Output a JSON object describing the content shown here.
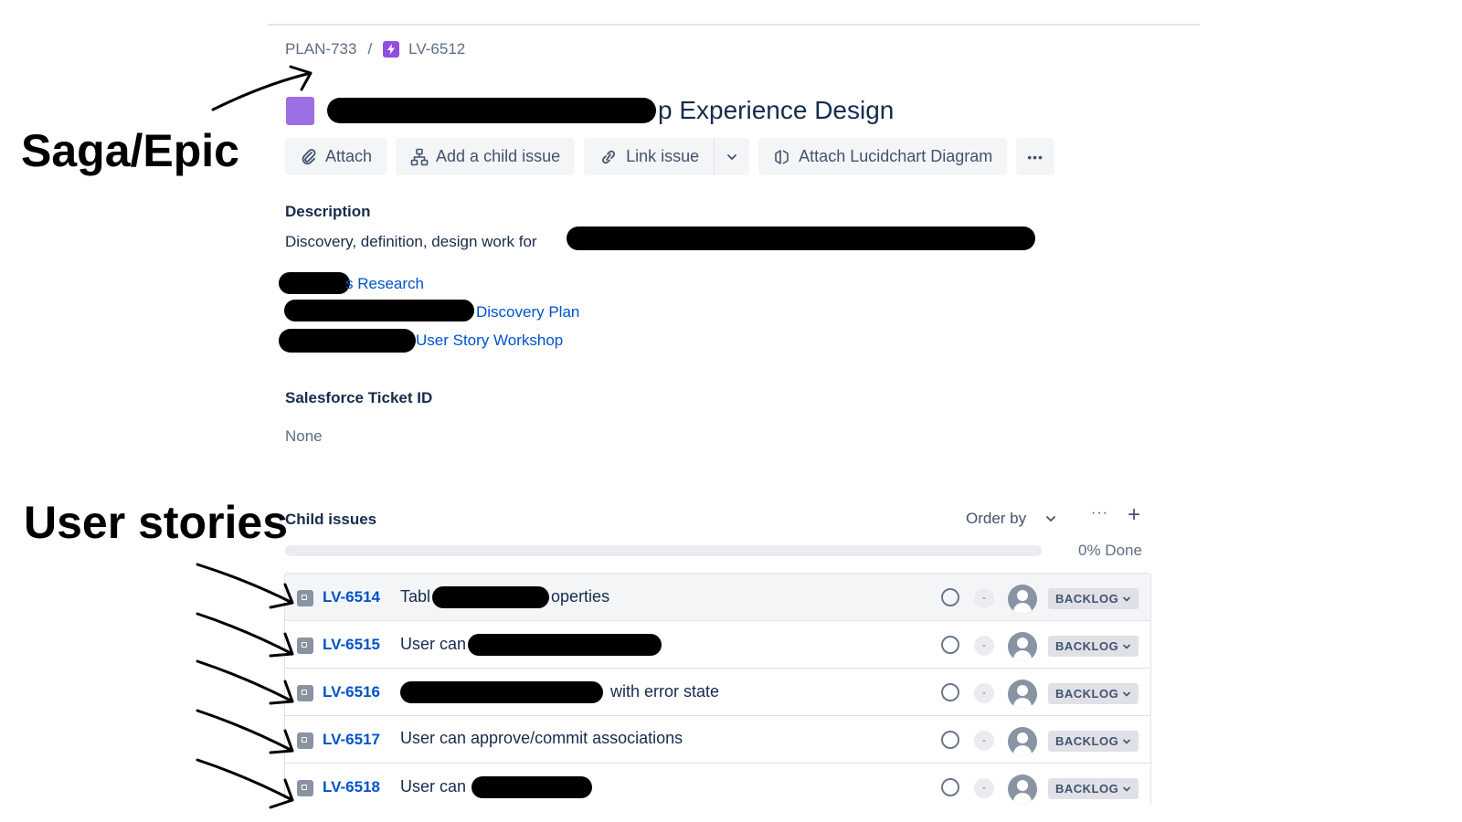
{
  "breadcrumb": {
    "parent": "PLAN-733",
    "separator": "/",
    "current": "LV-6512"
  },
  "issue": {
    "title_suffix": "p Experience Design",
    "epic_color": "#9c6fe4"
  },
  "toolbar": {
    "attach": "Attach",
    "add_child": "Add a child issue",
    "link_issue": "Link issue",
    "lucidchart": "Attach Lucidchart Diagram",
    "more": "•••"
  },
  "description": {
    "label": "Description",
    "text": "Discovery, definition, design work for",
    "links": [
      "s Research",
      "Discovery Plan",
      "User Story Workshop"
    ]
  },
  "salesforce": {
    "label": "Salesforce Ticket ID",
    "value": "None"
  },
  "child_issues": {
    "label": "Child issues",
    "order_by": "Order by",
    "more": "···",
    "add": "+",
    "progress_percent": 0,
    "done_text": "0% Done",
    "items": [
      {
        "key": "LV-6514",
        "summary_pre": "Tabl",
        "summary_post": "operties",
        "status": "BACKLOG",
        "priority": "-"
      },
      {
        "key": "LV-6515",
        "summary_pre": "User can",
        "summary_post": "",
        "status": "BACKLOG",
        "priority": "-"
      },
      {
        "key": "LV-6516",
        "summary_pre": "",
        "summary_post": "with error state",
        "status": "BACKLOG",
        "priority": "-"
      },
      {
        "key": "LV-6517",
        "summary_pre": "User can approve/commit associations",
        "summary_post": "",
        "status": "BACKLOG",
        "priority": "-"
      },
      {
        "key": "LV-6518",
        "summary_pre": "User can",
        "summary_post": "",
        "status": "BACKLOG",
        "priority": "-"
      }
    ]
  },
  "annotations": {
    "epic": "Saga/Epic",
    "stories": "User stories"
  },
  "colors": {
    "link": "#0052cc",
    "text": "#172b4d",
    "muted": "#5e6c84",
    "epic": "#904ee2"
  }
}
